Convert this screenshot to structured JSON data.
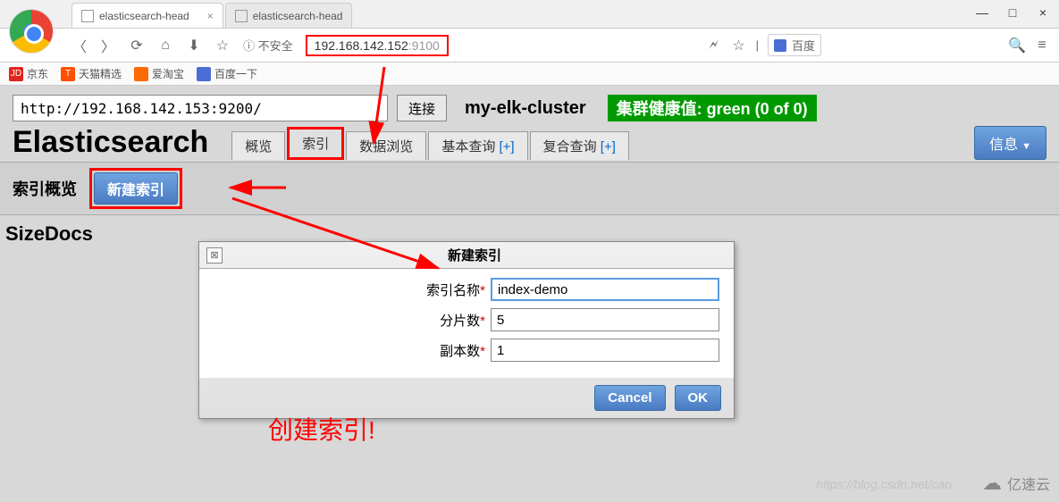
{
  "browser": {
    "tab1": "elasticsearch-head",
    "tab2": "elasticsearch-head",
    "security_label": "不安全",
    "url_host": "192.168.142.152",
    "url_port": ":9100",
    "search_placeholder": "百度"
  },
  "bookmarks": {
    "jd": "京东",
    "tmall": "天猫精选",
    "aitao": "爱淘宝",
    "baidu": "百度一下"
  },
  "app": {
    "conn_url": "http://192.168.142.153:9200/",
    "conn_btn": "连接",
    "cluster_name": "my-elk-cluster",
    "health": "集群健康值: green (0 of 0)",
    "title": "Elasticsearch",
    "tabs": {
      "overview": "概览",
      "indices": "索引",
      "browse": "数据浏览",
      "basic": "基本查询",
      "compound": "复合查询",
      "plus": "[+]"
    },
    "info_btn": "信息",
    "subbar_title": "索引概览",
    "new_index_btn": "新建索引",
    "sizedocs": "SizeDocs"
  },
  "dialog": {
    "title": "新建索引",
    "name_label": "索引名称",
    "name_value": "index-demo",
    "shards_label": "分片数",
    "shards_value": "5",
    "replicas_label": "副本数",
    "replicas_value": "1",
    "cancel": "Cancel",
    "ok": "OK"
  },
  "annotation": "创建索引!",
  "watermark": "https://blog.csdn.net/cao",
  "yisu": "亿速云"
}
